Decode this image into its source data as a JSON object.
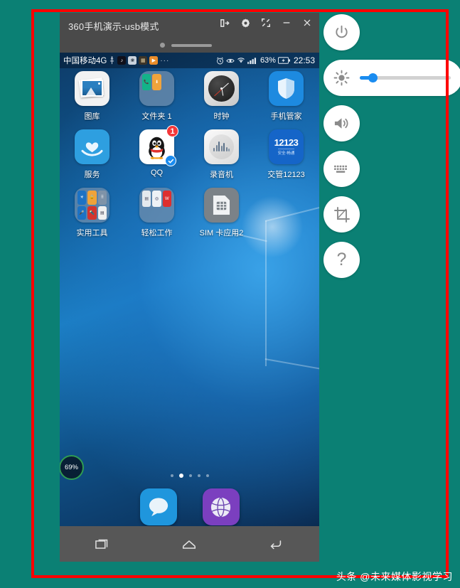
{
  "window": {
    "title": "360手机演示-usb模式",
    "controls": [
      {
        "name": "transfer-icon",
        "label": "传输"
      },
      {
        "name": "gear-icon",
        "label": "设置"
      },
      {
        "name": "fullscreen-icon",
        "label": "全屏"
      },
      {
        "name": "minimize-icon",
        "label": "最小化"
      },
      {
        "name": "close-icon",
        "label": "关闭"
      }
    ]
  },
  "statusbar": {
    "carrier": "中国移动4G",
    "notification_icons": [
      "usb-icon",
      "douyin-icon",
      "wechat-icon",
      "app-icon",
      "media-player-icon",
      "more-dots-icon"
    ],
    "right_icons": [
      "alarm-icon",
      "eye-comfort-icon",
      "wifi-icon",
      "signal-icon"
    ],
    "battery_percent": "63%",
    "battery_icon": "battery-charging-icon",
    "time": "22:53"
  },
  "homescreen": {
    "rows": [
      [
        {
          "label": "图库",
          "icon": "gallery-icon"
        },
        {
          "label": "文件夹 1",
          "icon": "folder-icon"
        },
        {
          "label": "时钟",
          "icon": "clock-icon"
        },
        {
          "label": "手机管家",
          "icon": "phone-manager-shield-icon"
        }
      ],
      [
        {
          "label": "服务",
          "icon": "services-heart-icon"
        },
        {
          "label": "QQ",
          "icon": "qq-penguin-icon",
          "badge": "1",
          "verified": true
        },
        {
          "label": "录音机",
          "icon": "recorder-icon"
        },
        {
          "label": "交管12123",
          "icon": "traffic-12123-icon",
          "icon_text": "12123",
          "icon_subtext": "安全·畅通"
        }
      ],
      [
        {
          "label": "实用工具",
          "icon": "folder-icon"
        },
        {
          "label": "轻松工作",
          "icon": "folder-icon"
        },
        {
          "label": "SIM 卡应用2",
          "icon": "sim-card-icon"
        }
      ]
    ],
    "battery_widget": "69%",
    "page_count": 5,
    "active_page": 2,
    "dock": [
      {
        "label": "信息",
        "icon": "messages-icon"
      },
      {
        "label": "浏览器",
        "icon": "browser-globe-icon"
      }
    ],
    "android_nav": [
      "back-triangle-icon",
      "home-circle-icon",
      "recents-square-icon"
    ]
  },
  "app_toolbar": [
    {
      "name": "recents-icon",
      "label": "任务"
    },
    {
      "name": "home-icon",
      "label": "主页"
    },
    {
      "name": "back-icon",
      "label": "返回"
    }
  ],
  "sidebar": {
    "buttons": [
      {
        "name": "power-icon",
        "label": "电源"
      },
      {
        "name": "volume-icon",
        "label": "音量"
      },
      {
        "name": "keyboard-icon",
        "label": "键盘"
      },
      {
        "name": "screenshot-crop-icon",
        "label": "截屏"
      },
      {
        "name": "help-icon",
        "label": "帮助"
      }
    ],
    "brightness": {
      "icon": "brightness-sun-icon",
      "value": 9
    }
  },
  "annotation": {
    "border_color": "#fe0000"
  },
  "watermark": "头条 @未来媒体影视学习",
  "colors": {
    "background": "#0b8074",
    "accent": "#1a8cf0",
    "badge": "#f5383a"
  }
}
